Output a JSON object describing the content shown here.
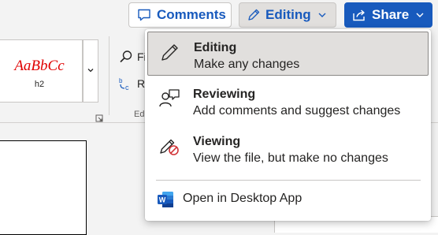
{
  "header": {
    "comments_label": "Comments",
    "editing_label": "Editing",
    "share_label": "Share"
  },
  "ribbon": {
    "style_sample": "AaBbCc",
    "style_name": "h2",
    "find_label": "Fi",
    "replace_label": "R",
    "group_label": "Edi"
  },
  "mode_menu": {
    "items": [
      {
        "title": "Editing",
        "description": "Make any changes",
        "icon": "pencil-icon",
        "selected": true
      },
      {
        "title": "Reviewing",
        "description": "Add comments and suggest changes",
        "icon": "reviewing-icon",
        "selected": false
      },
      {
        "title": "Viewing",
        "description": "View the file, but make no changes",
        "icon": "viewing-icon",
        "selected": false
      }
    ],
    "open_desktop_label": "Open in Desktop App"
  },
  "colors": {
    "accent_blue": "#185abd",
    "word_blue": "#185abd",
    "selected_bg": "#e1dfdd",
    "style_red": "#e00000",
    "no_edit_red": "#d13438"
  }
}
